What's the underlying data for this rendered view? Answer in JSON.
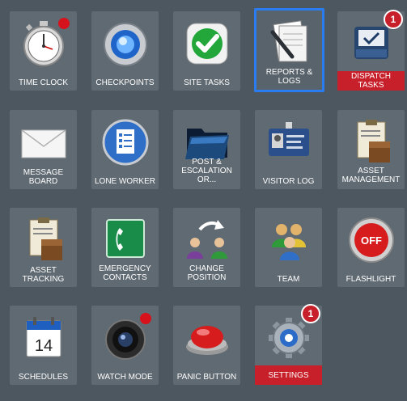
{
  "tiles": [
    {
      "label": "TIME CLOCK",
      "icon": "stopwatch-icon"
    },
    {
      "label": "CHECKPOINTS",
      "icon": "checkpoint-orb-icon"
    },
    {
      "label": "SITE TASKS",
      "icon": "checkmark-icon"
    },
    {
      "label": "REPORTS & LOGS",
      "icon": "reports-pen-icon"
    },
    {
      "label": "DISPATCH TASKS",
      "icon": "dispatch-inbox-icon",
      "badge": "1"
    },
    {
      "label": "MESSAGE BOARD",
      "icon": "envelope-icon"
    },
    {
      "label": "LONE WORKER",
      "icon": "checklist-orb-icon"
    },
    {
      "label": "POST & ESCALATION OR...",
      "icon": "folder-icon"
    },
    {
      "label": "VISITOR LOG",
      "icon": "id-badge-icon"
    },
    {
      "label": "ASSET MANAGEMENT",
      "icon": "clipboard-box-icon"
    },
    {
      "label": "ASSET TRACKING",
      "icon": "clipboard-box-icon"
    },
    {
      "label": "EMERGENCY CONTACTS",
      "icon": "phone-icon"
    },
    {
      "label": "CHANGE POSITION",
      "icon": "swap-users-icon"
    },
    {
      "label": "TEAM",
      "icon": "team-icon"
    },
    {
      "label": "FLASHLIGHT",
      "icon": "off-button-icon"
    },
    {
      "label": "SCHEDULES",
      "icon": "calendar-icon"
    },
    {
      "label": "WATCH MODE",
      "icon": "camera-lens-icon"
    },
    {
      "label": "PANIC BUTTON",
      "icon": "red-button-icon"
    },
    {
      "label": "SETTINGS",
      "icon": "gear-icon",
      "badge": "1"
    }
  ],
  "calendar_day": "14",
  "flashlight_text": "OFF",
  "colors": {
    "background": "#4d575f",
    "tile": "#606a72",
    "selected_outline": "#2a7df0",
    "alert_red": "#c8202a"
  }
}
